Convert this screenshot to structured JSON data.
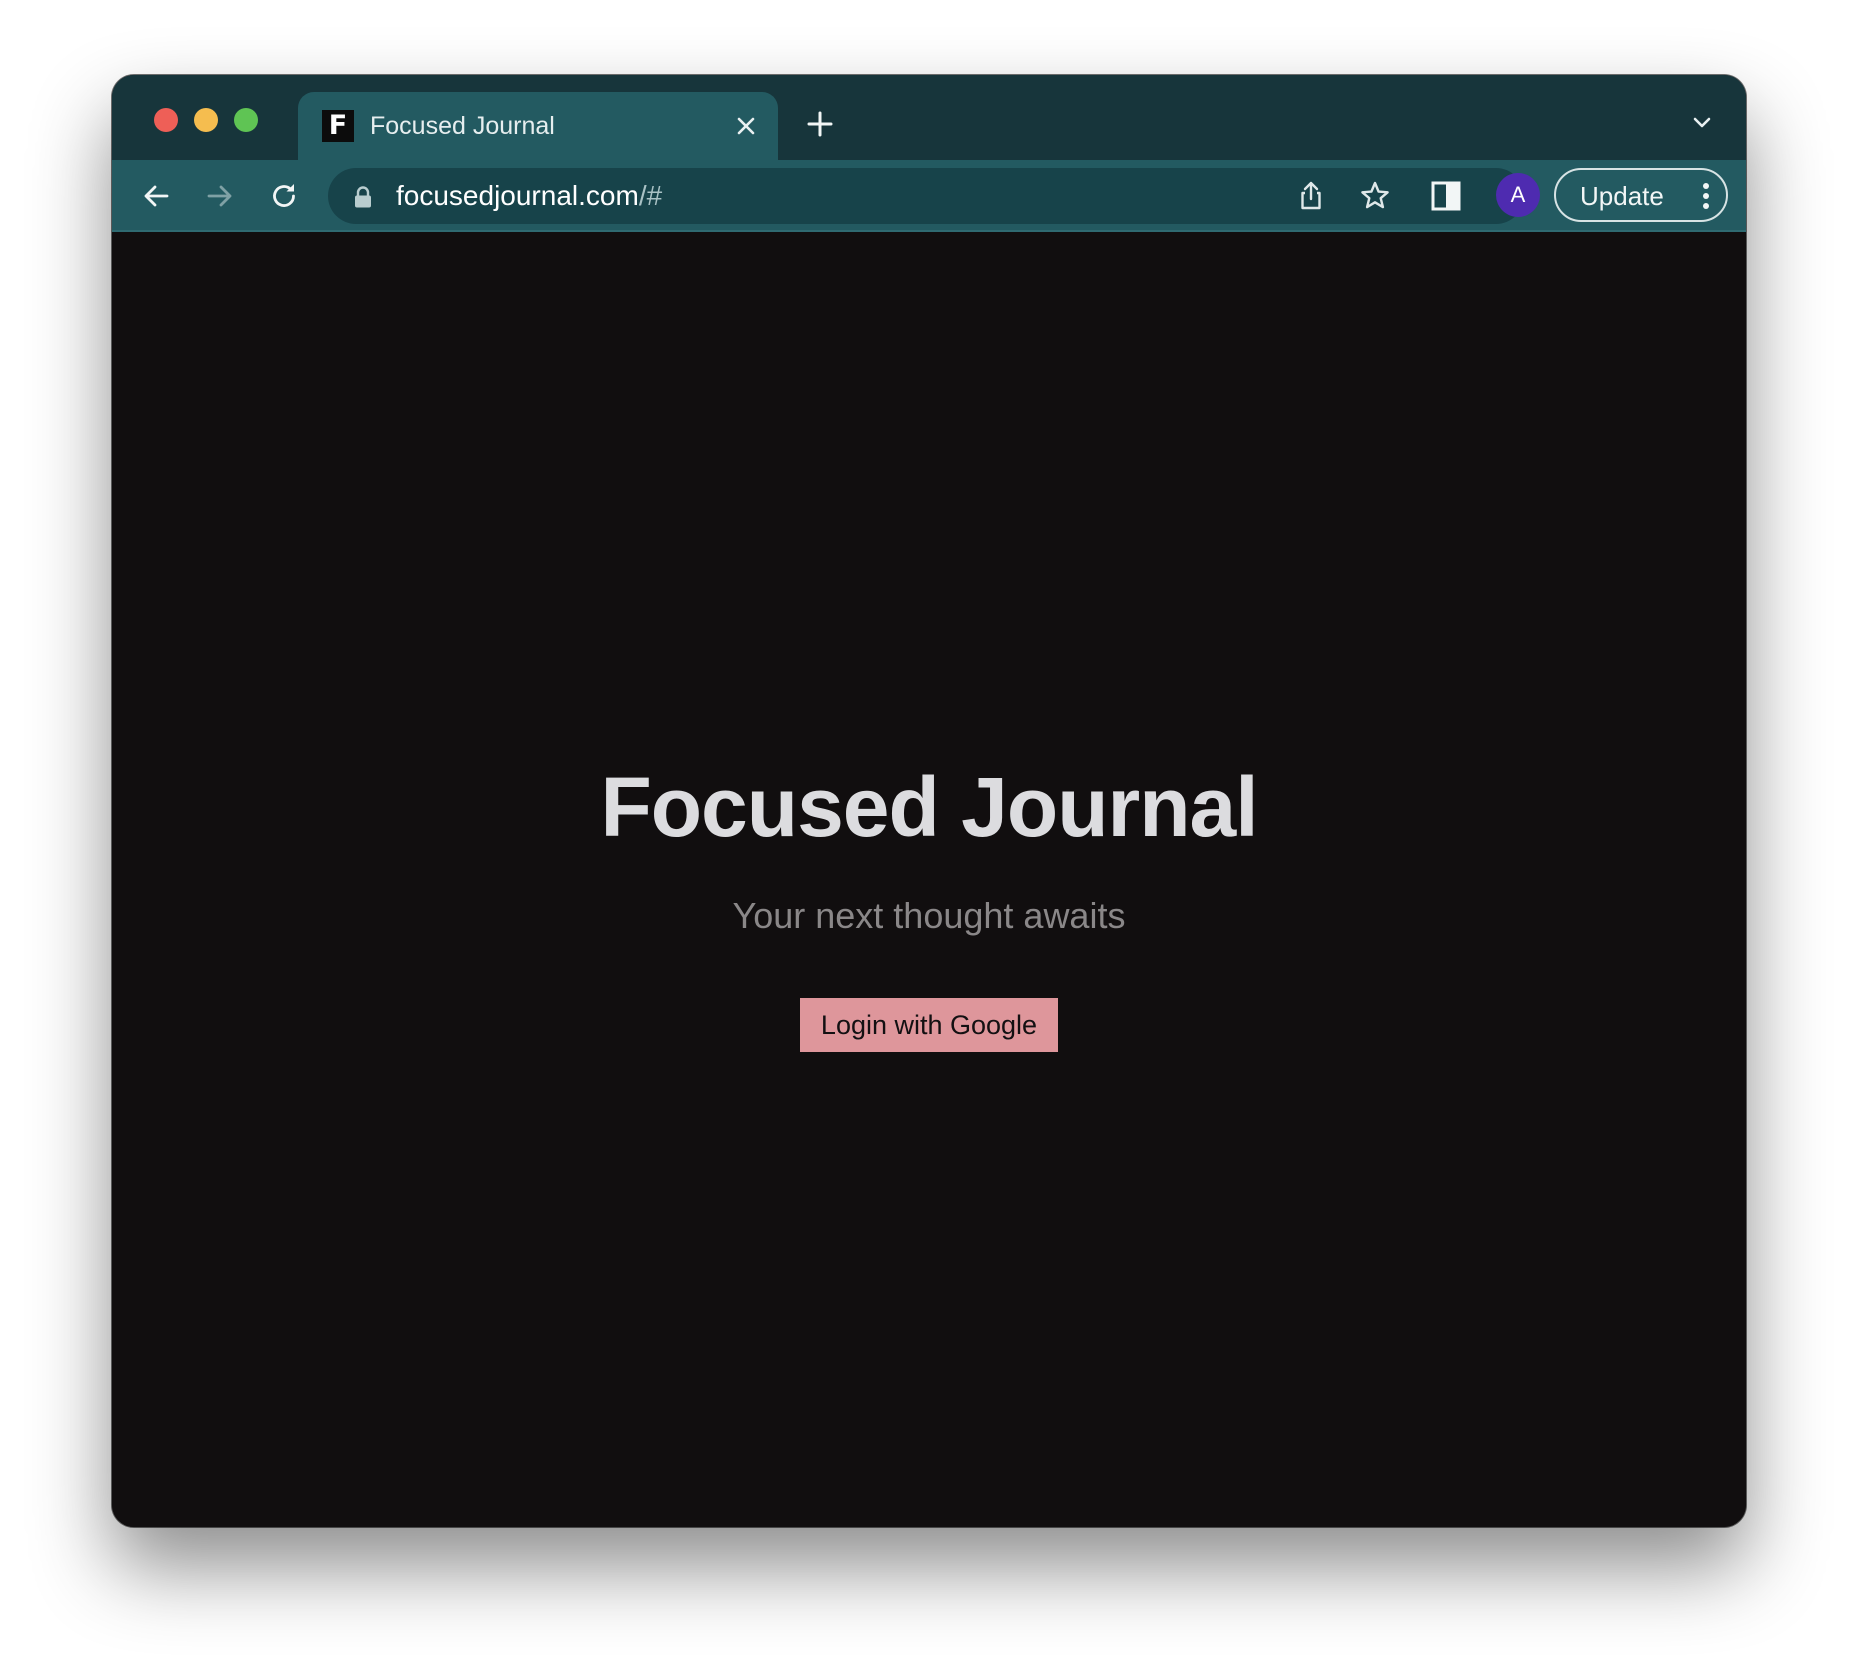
{
  "browser": {
    "tab": {
      "favicon_letter": "F",
      "title": "Focused Journal"
    },
    "address_bar": {
      "host": "focusedjournal.com",
      "path": "/#"
    },
    "profile_initial": "A",
    "update_label": "Update",
    "icons": {
      "close_tab": "close-icon",
      "new_tab": "plus-icon",
      "tab_list": "chevron-down-icon",
      "back": "arrow-left-icon",
      "forward": "arrow-right-icon",
      "reload": "reload-icon",
      "lock": "lock-icon",
      "share": "share-icon",
      "bookmark": "star-icon",
      "side_panel": "side-panel-icon",
      "menu": "kebab-menu-icon"
    }
  },
  "page": {
    "title": "Focused Journal",
    "subtitle": "Your next thought awaits",
    "login_button": "Login with Google"
  },
  "colors": {
    "tab_strip": "#17353b",
    "toolbar": "#235a61",
    "page_background": "#110e0f",
    "button": "#de969b",
    "avatar": "#4e2bb0"
  }
}
